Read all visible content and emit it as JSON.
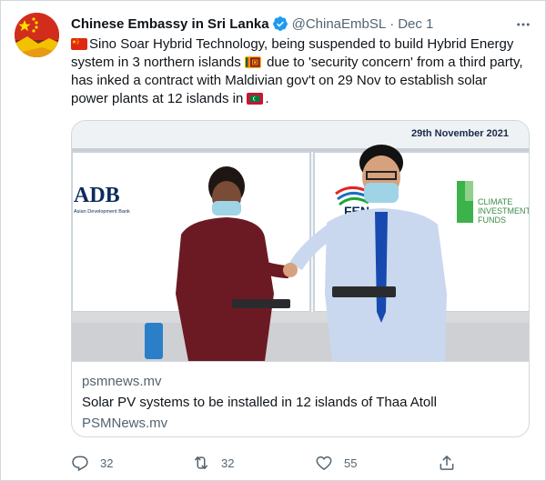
{
  "author": {
    "name": "Chinese Embassy in Sri Lanka",
    "handle": "@ChinaEmbSL",
    "separator": "·",
    "date": "Dec 1"
  },
  "tweet": {
    "line1": "Sino Soar Hybrid Technology, being suspended to build Hybrid Energy",
    "line2a": "system in 3 northern islands ",
    "line2b": " due to 'security concern' from a third party,",
    "line3": "has inked a contract with Maldivian gov't on 29 Nov to establish solar",
    "line4": "power plants at 12 islands in ",
    "line4end": "."
  },
  "card": {
    "image": {
      "date_text": "29th November 2021",
      "logo_adb": "ADB",
      "logo_adb_sub": "Asian Development Bank",
      "logo_fen": "FEN",
      "logo_cif_line1": "CLIMATE",
      "logo_cif_line2": "INVESTMENT",
      "logo_cif_line3": "FUNDS"
    },
    "domain": "psmnews.mv",
    "title": "Solar PV systems to be installed in 12 islands of Thaa Atoll",
    "site": "PSMNews.mv"
  },
  "actions": {
    "replies": "32",
    "retweets": "32",
    "likes": "55"
  },
  "colors": {
    "secondary_text": "#536471",
    "verified": "#1d9bf0",
    "border": "#cfd9de"
  }
}
